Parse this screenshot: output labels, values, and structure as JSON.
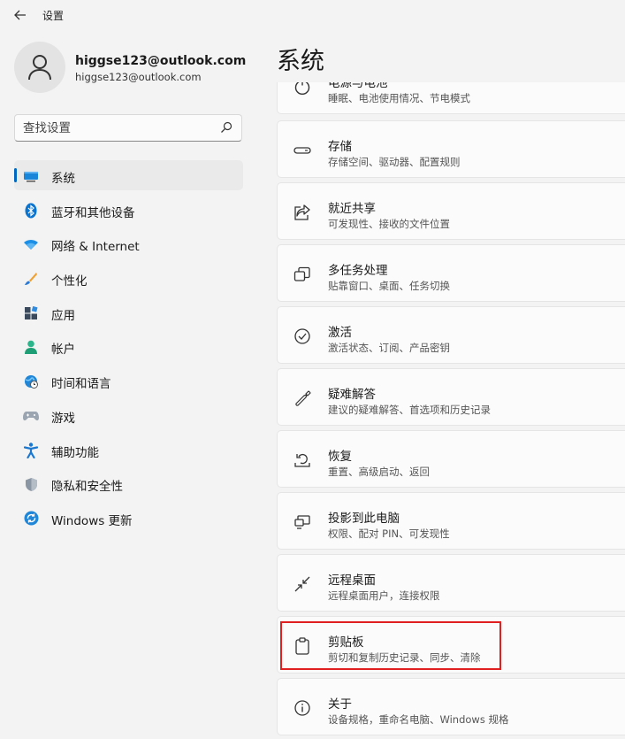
{
  "window": {
    "title": "设置"
  },
  "profile": {
    "name": "higgse123@outlook.com",
    "email": "higgse123@outlook.com"
  },
  "search": {
    "placeholder": "查找设置"
  },
  "nav": {
    "items": [
      {
        "id": "system",
        "label": "系统",
        "icon": "system-display-icon",
        "selected": true
      },
      {
        "id": "bluetooth",
        "label": "蓝牙和其他设备",
        "icon": "bluetooth-icon"
      },
      {
        "id": "network",
        "label": "网络 & Internet",
        "icon": "wifi-icon"
      },
      {
        "id": "personalization",
        "label": "个性化",
        "icon": "brush-icon"
      },
      {
        "id": "apps",
        "label": "应用",
        "icon": "apps-icon"
      },
      {
        "id": "accounts",
        "label": "帐户",
        "icon": "person-icon"
      },
      {
        "id": "time",
        "label": "时间和语言",
        "icon": "globe-clock-icon"
      },
      {
        "id": "gaming",
        "label": "游戏",
        "icon": "gamepad-icon"
      },
      {
        "id": "accessibility",
        "label": "辅助功能",
        "icon": "accessibility-icon"
      },
      {
        "id": "privacy",
        "label": "隐私和安全性",
        "icon": "shield-icon"
      },
      {
        "id": "update",
        "label": "Windows 更新",
        "icon": "windows-update-icon"
      }
    ]
  },
  "main": {
    "title": "系统",
    "cards": [
      {
        "id": "power",
        "title": "电源与电池",
        "subtitle": "睡眠、电池使用情况、节电模式",
        "icon": "power-icon"
      },
      {
        "id": "storage",
        "title": "存储",
        "subtitle": "存储空间、驱动器、配置规则",
        "icon": "storage-drive-icon"
      },
      {
        "id": "nearby",
        "title": "就近共享",
        "subtitle": "可发现性、接收的文件位置",
        "icon": "share-icon"
      },
      {
        "id": "multitask",
        "title": "多任务处理",
        "subtitle": "贴靠窗口、桌面、任务切换",
        "icon": "multitask-icon"
      },
      {
        "id": "activation",
        "title": "激活",
        "subtitle": "激活状态、订阅、产品密钥",
        "icon": "check-circle-icon"
      },
      {
        "id": "troubleshoot",
        "title": "疑难解答",
        "subtitle": "建议的疑难解答、首选项和历史记录",
        "icon": "wrench-icon"
      },
      {
        "id": "recovery",
        "title": "恢复",
        "subtitle": "重置、高级启动、返回",
        "icon": "recovery-icon"
      },
      {
        "id": "projecting",
        "title": "投影到此电脑",
        "subtitle": "权限、配对 PIN、可发现性",
        "icon": "projection-icon"
      },
      {
        "id": "remote",
        "title": "远程桌面",
        "subtitle": "远程桌面用户，连接权限",
        "icon": "remote-desktop-icon"
      },
      {
        "id": "clipboard",
        "title": "剪贴板",
        "subtitle": "剪切和复制历史记录、同步、清除",
        "icon": "clipboard-icon",
        "highlighted": true
      },
      {
        "id": "about",
        "title": "关于",
        "subtitle": "设备规格，重命名电脑、Windows 规格",
        "icon": "info-icon"
      }
    ]
  },
  "colors": {
    "accent": "#0067c0",
    "highlight": "#e02020",
    "background": "#f3f3f3",
    "card": "#fbfbfb"
  }
}
